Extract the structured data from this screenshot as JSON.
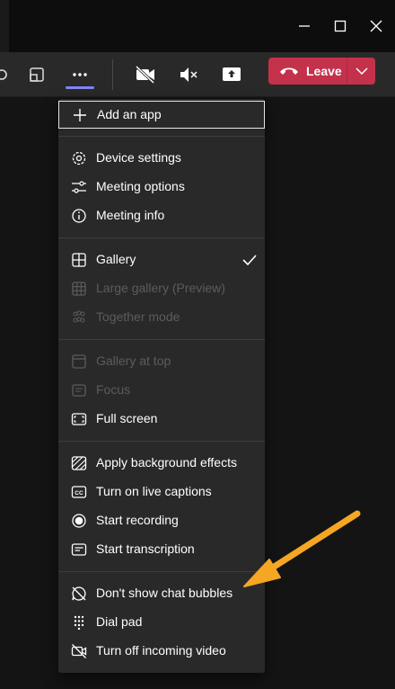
{
  "window": {
    "minimize_icon": "minimize-icon",
    "maximize_icon": "maximize-icon",
    "close_icon": "close-icon"
  },
  "toolbar": {
    "leave_label": "Leave",
    "accent": "#7f85f5",
    "leave_color": "#c4314b"
  },
  "menu": {
    "add_app": "Add an app",
    "group1": [
      {
        "label": "Device settings",
        "icon": "gear-icon",
        "enabled": true
      },
      {
        "label": "Meeting options",
        "icon": "sliders-icon",
        "enabled": true
      },
      {
        "label": "Meeting info",
        "icon": "info-icon",
        "enabled": true
      }
    ],
    "group2": [
      {
        "label": "Gallery",
        "icon": "gallery-icon",
        "enabled": true,
        "checked": true
      },
      {
        "label": "Large gallery (Preview)",
        "icon": "large-gallery-icon",
        "enabled": false
      },
      {
        "label": "Together mode",
        "icon": "together-mode-icon",
        "enabled": false
      }
    ],
    "group3": [
      {
        "label": "Gallery at top",
        "icon": "gallery-top-icon",
        "enabled": false
      },
      {
        "label": "Focus",
        "icon": "focus-icon",
        "enabled": false
      },
      {
        "label": "Full screen",
        "icon": "fullscreen-icon",
        "enabled": true
      }
    ],
    "group4": [
      {
        "label": "Apply background effects",
        "icon": "background-effects-icon",
        "enabled": true
      },
      {
        "label": "Turn on live captions",
        "icon": "captions-icon",
        "enabled": true
      },
      {
        "label": "Start recording",
        "icon": "record-icon",
        "enabled": true
      },
      {
        "label": "Start transcription",
        "icon": "transcription-icon",
        "enabled": true
      }
    ],
    "group5": [
      {
        "label": "Don't show chat bubbles",
        "icon": "chat-bubbles-off-icon",
        "enabled": true
      },
      {
        "label": "Dial pad",
        "icon": "dialpad-icon",
        "enabled": true
      },
      {
        "label": "Turn off incoming video",
        "icon": "video-off-icon",
        "enabled": true
      }
    ]
  },
  "annotation": {
    "arrow_color": "#f5a623"
  }
}
